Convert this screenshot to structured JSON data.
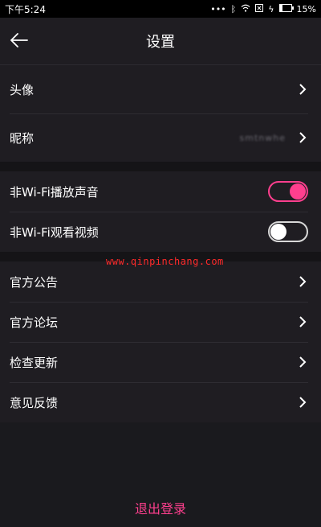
{
  "status_bar": {
    "time": "下午5:24",
    "battery_text": "15%"
  },
  "header": {
    "title": "设置"
  },
  "profile": {
    "avatar_label": "头像",
    "nickname_label": "昵称",
    "nickname_value": "smtnwhe"
  },
  "media": {
    "non_wifi_audio_label": "非Wi-Fi播放声音",
    "non_wifi_audio_on": true,
    "non_wifi_video_label": "非Wi-Fi观看视频",
    "non_wifi_video_on": false
  },
  "watermark": "www.qinpinchang.com",
  "misc": {
    "items": [
      {
        "label": "官方公告"
      },
      {
        "label": "官方论坛"
      },
      {
        "label": "检查更新"
      },
      {
        "label": "意见反馈"
      }
    ]
  },
  "logout_label": "退出登录",
  "colors": {
    "accent": "#ff3f8e",
    "background": "#1a1a1e",
    "row_background": "#1f1d22"
  }
}
